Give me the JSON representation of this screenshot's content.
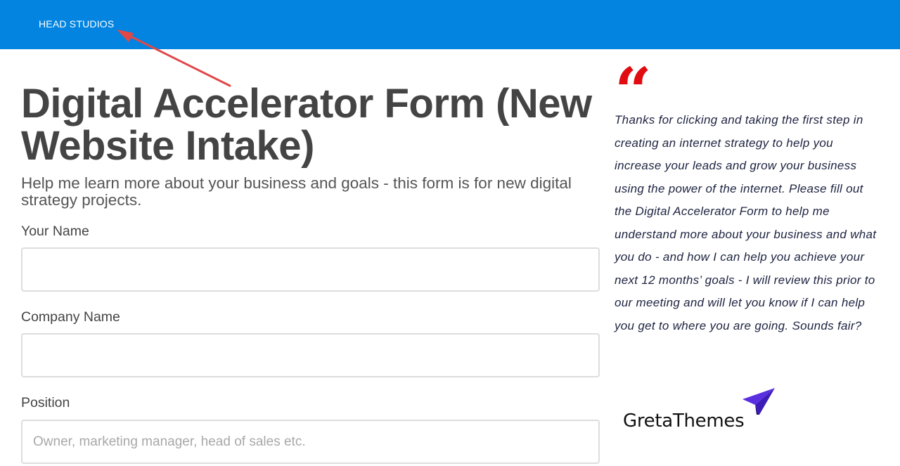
{
  "header": {
    "brand": "HEAD STUDIOS",
    "background_color": "#0284e0"
  },
  "form": {
    "title": "Digital Accelerator Form (New Website Intake)",
    "subtitle": "Help me learn more about your business and goals - this form is for new digital strategy projects.",
    "fields": [
      {
        "label": "Your Name",
        "value": "",
        "placeholder": ""
      },
      {
        "label": "Company Name",
        "value": "",
        "placeholder": ""
      },
      {
        "label": "Position",
        "value": "",
        "placeholder": "Owner, marketing manager, head of sales etc."
      }
    ]
  },
  "sidebar": {
    "quote_mark": "“",
    "quote_color": "#e10b12",
    "quote_text": "Thanks for clicking and taking the first step in creating an internet strategy to help you increase your leads and grow your business using the power of the internet. Please fill out the Digital Accelerator Form to help me understand more about your business and what you do - and how I can help you achieve your next 12 months’ goals - I will review this prior to our meeting and will let you know if I can help you get to where you are going. Sounds fair?",
    "logo_text": "GretaThemes",
    "logo_icon": "paper-plane-icon",
    "logo_color": "#5a2fe0"
  },
  "annotation": {
    "arrow_color": "#e04848"
  }
}
